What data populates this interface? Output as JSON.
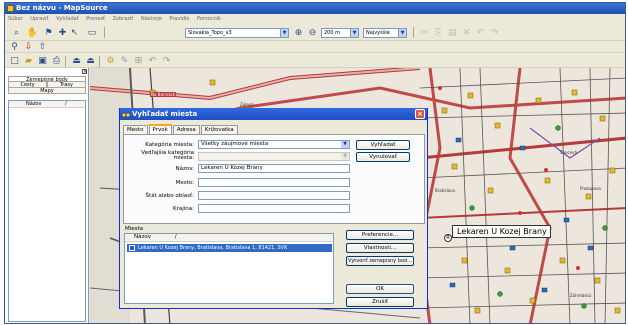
{
  "window": {
    "title": "Bez názvu - MapSource"
  },
  "menu": [
    "Súbor",
    "Upraviť",
    "Vyhľadať",
    "Prenesť",
    "Zobraziť",
    "Nástroje",
    "Pravidlo",
    "Pomocník"
  ],
  "toolbar": {
    "map_product": "Slovakia_Topo_v3",
    "zoom_level": "200 m",
    "detail_level": "Najvyššie"
  },
  "left_panel": {
    "tab_top": "Zemepisné body",
    "tab_row": [
      "Cesty",
      "Trasy"
    ],
    "tab_maps": "Mapy",
    "column_header": "Názov",
    "sort_indicator": "/"
  },
  "map": {
    "labels": [
      "Na Barinách",
      "Zelená",
      "Šancová",
      "Bratislava",
      "Prokopova",
      "Záhrebská"
    ],
    "callout": "Lekaren U Kozej Brany",
    "callout_pin": "R"
  },
  "dialog": {
    "title": "Vyhľadať miesta",
    "close": "×",
    "tabs": [
      "Mesto",
      "Prvok",
      "Adresa",
      "Križovatka"
    ],
    "active_tab": 1,
    "fields": {
      "category_label": "Kategória miesta:",
      "category_value": "Všetky záujmové miesta",
      "subcategory_label": "Vedľajšia kategória miesta:",
      "subcategory_value": "",
      "name_label": "Názov:",
      "name_value": "Lekaren U Kozej Brany",
      "city_label": "Mesto:",
      "city_value": "",
      "state_label": "Štát alebo oblasť:",
      "state_value": "",
      "country_label": "Krajina:",
      "country_value": ""
    },
    "buttons": {
      "search": "Vyhľadať",
      "reset": "Vynulovať",
      "preferences": "Preferencie...",
      "properties": "Vlastnosti...",
      "create_waypoint": "Vytvoriť zemepisný bod...",
      "ok": "OK",
      "cancel": "Zrušiť"
    },
    "results": {
      "group_label": "Miesta",
      "column": "Názov",
      "sort_indicator": "/",
      "rows": [
        "Lekaren U Kozej Brany, Bratislava, Bratislava 1, 81421, SVK"
      ]
    }
  }
}
